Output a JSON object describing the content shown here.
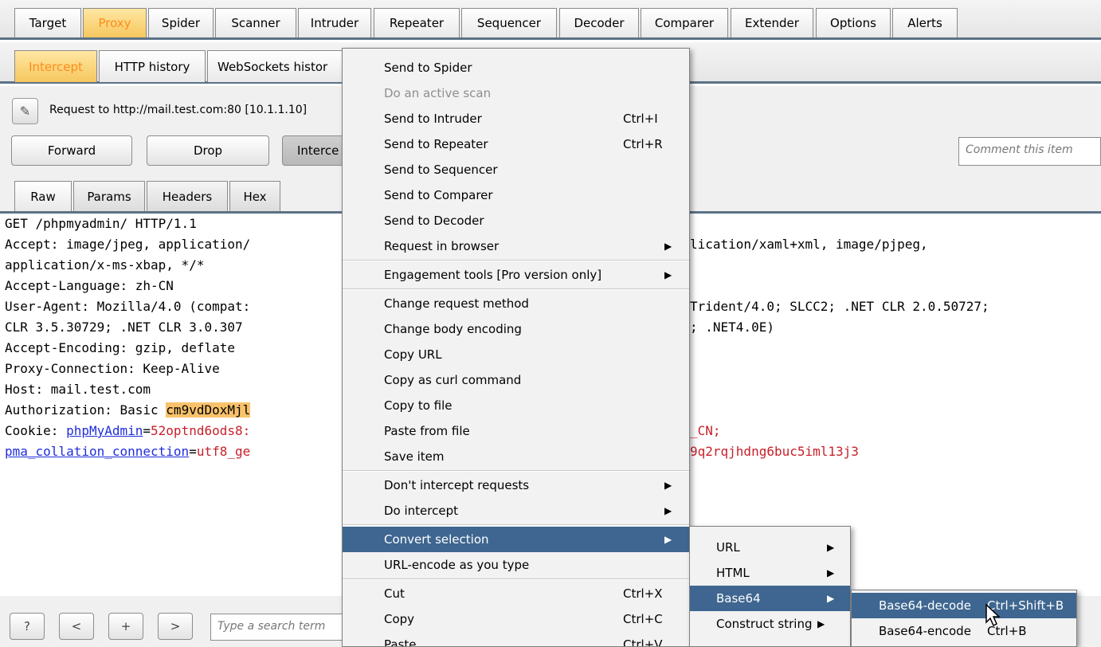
{
  "main_tabs": [
    {
      "label": "Target"
    },
    {
      "label": "Proxy"
    },
    {
      "label": "Spider"
    },
    {
      "label": "Scanner"
    },
    {
      "label": "Intruder"
    },
    {
      "label": "Repeater"
    },
    {
      "label": "Sequencer"
    },
    {
      "label": "Decoder"
    },
    {
      "label": "Comparer"
    },
    {
      "label": "Extender"
    },
    {
      "label": "Options"
    },
    {
      "label": "Alerts"
    }
  ],
  "proxy_tabs": [
    {
      "label": "Intercept"
    },
    {
      "label": "HTTP history"
    },
    {
      "label": "WebSockets histor"
    }
  ],
  "intercept": {
    "request_label": "Request to http://mail.test.com:80  [10.1.1.10]",
    "forward_label": "Forward",
    "drop_label": "Drop",
    "intercept_label": "Interce",
    "comment_placeholder": "Comment this item"
  },
  "view_tabs": [
    {
      "label": "Raw"
    },
    {
      "label": "Params"
    },
    {
      "label": "Headers"
    },
    {
      "label": "Hex"
    }
  ],
  "request": {
    "line1": "GET /phpmyadmin/ HTTP/1.1",
    "line2a": "Accept: image/jpeg, application/",
    "line2b": "lication/xaml+xml, image/pjpeg,",
    "line3": "application/x-ms-xbap, */*",
    "line4": "Accept-Language: zh-CN",
    "line5a": "User-Agent: Mozilla/4.0 (compat:",
    "line5b": "Trident/4.0; SLCC2; .NET CLR 2.0.50727;",
    "line6a": "CLR 3.5.30729; .NET CLR 3.0.307",
    "line6b": "; .NET4.0E)",
    "line7": "Accept-Encoding: gzip, deflate",
    "line8": "Proxy-Connection: Keep-Alive",
    "line9": "Host: mail.test.com",
    "auth_prefix": "Authorization: Basic ",
    "auth_value": "cm9vdDoxMjl",
    "cookie_prefix": "Cookie: ",
    "cookie_name": "phpMyAdmin",
    "cookie_eq": "=",
    "cookie_value": "52optnd6ods8:",
    "cookie_value_b": "_CN;",
    "pma_name": "pma_collation_connection",
    "pma_eq": "=",
    "pma_value": "utf8_ge",
    "pma_value_b": "9q2rqjhdng6buc5iml13j3"
  },
  "bottom": {
    "help_label": "?",
    "prev_label": "<",
    "add_label": "+",
    "next_label": ">",
    "search_placeholder": "Type a search term"
  },
  "context_menu": {
    "items": [
      {
        "label": "Send to Spider",
        "shortcut": "",
        "submenu": false
      },
      {
        "label": "Do an active scan",
        "shortcut": "",
        "submenu": false
      },
      {
        "label": "Send to Intruder",
        "shortcut": "Ctrl+I",
        "submenu": false
      },
      {
        "label": "Send to Repeater",
        "shortcut": "Ctrl+R",
        "submenu": false
      },
      {
        "label": "Send to Sequencer",
        "shortcut": "",
        "submenu": false
      },
      {
        "label": "Send to Comparer",
        "shortcut": "",
        "submenu": false
      },
      {
        "label": "Send to Decoder",
        "shortcut": "",
        "submenu": false
      },
      {
        "label": "Request in browser",
        "shortcut": "",
        "submenu": true
      },
      {
        "label": "Engagement tools [Pro version only]",
        "shortcut": "",
        "submenu": true
      },
      {
        "label": "Change request method",
        "shortcut": "",
        "submenu": false
      },
      {
        "label": "Change body encoding",
        "shortcut": "",
        "submenu": false
      },
      {
        "label": "Copy URL",
        "shortcut": "",
        "submenu": false
      },
      {
        "label": "Copy as curl command",
        "shortcut": "",
        "submenu": false
      },
      {
        "label": "Copy to file",
        "shortcut": "",
        "submenu": false
      },
      {
        "label": "Paste from file",
        "shortcut": "",
        "submenu": false
      },
      {
        "label": "Save item",
        "shortcut": "",
        "submenu": false
      },
      {
        "label": "Don't intercept requests",
        "shortcut": "",
        "submenu": true
      },
      {
        "label": "Do intercept",
        "shortcut": "",
        "submenu": true
      },
      {
        "label": "Convert selection",
        "shortcut": "",
        "submenu": true
      },
      {
        "label": "URL-encode as you type",
        "shortcut": "",
        "submenu": false
      },
      {
        "label": "Cut",
        "shortcut": "Ctrl+X",
        "submenu": false
      },
      {
        "label": "Copy",
        "shortcut": "Ctrl+C",
        "submenu": false
      },
      {
        "label": "Paste",
        "shortcut": "Ctrl+V",
        "submenu": false
      }
    ],
    "arrow": "▶"
  },
  "convert_submenu": {
    "items": [
      {
        "label": "URL"
      },
      {
        "label": "HTML"
      },
      {
        "label": "Base64"
      },
      {
        "label": "Construct string"
      }
    ]
  },
  "base64_submenu": {
    "items": [
      {
        "label": "Base64-decode",
        "shortcut": "Ctrl+Shift+B"
      },
      {
        "label": "Base64-encode",
        "shortcut": "Ctrl+B"
      }
    ]
  },
  "colors": {
    "accent_orange": "#ff8c1a",
    "selection_blue": "#3e6690",
    "tab_border_blue": "#5b7287",
    "highlight": "#f8c26b"
  }
}
